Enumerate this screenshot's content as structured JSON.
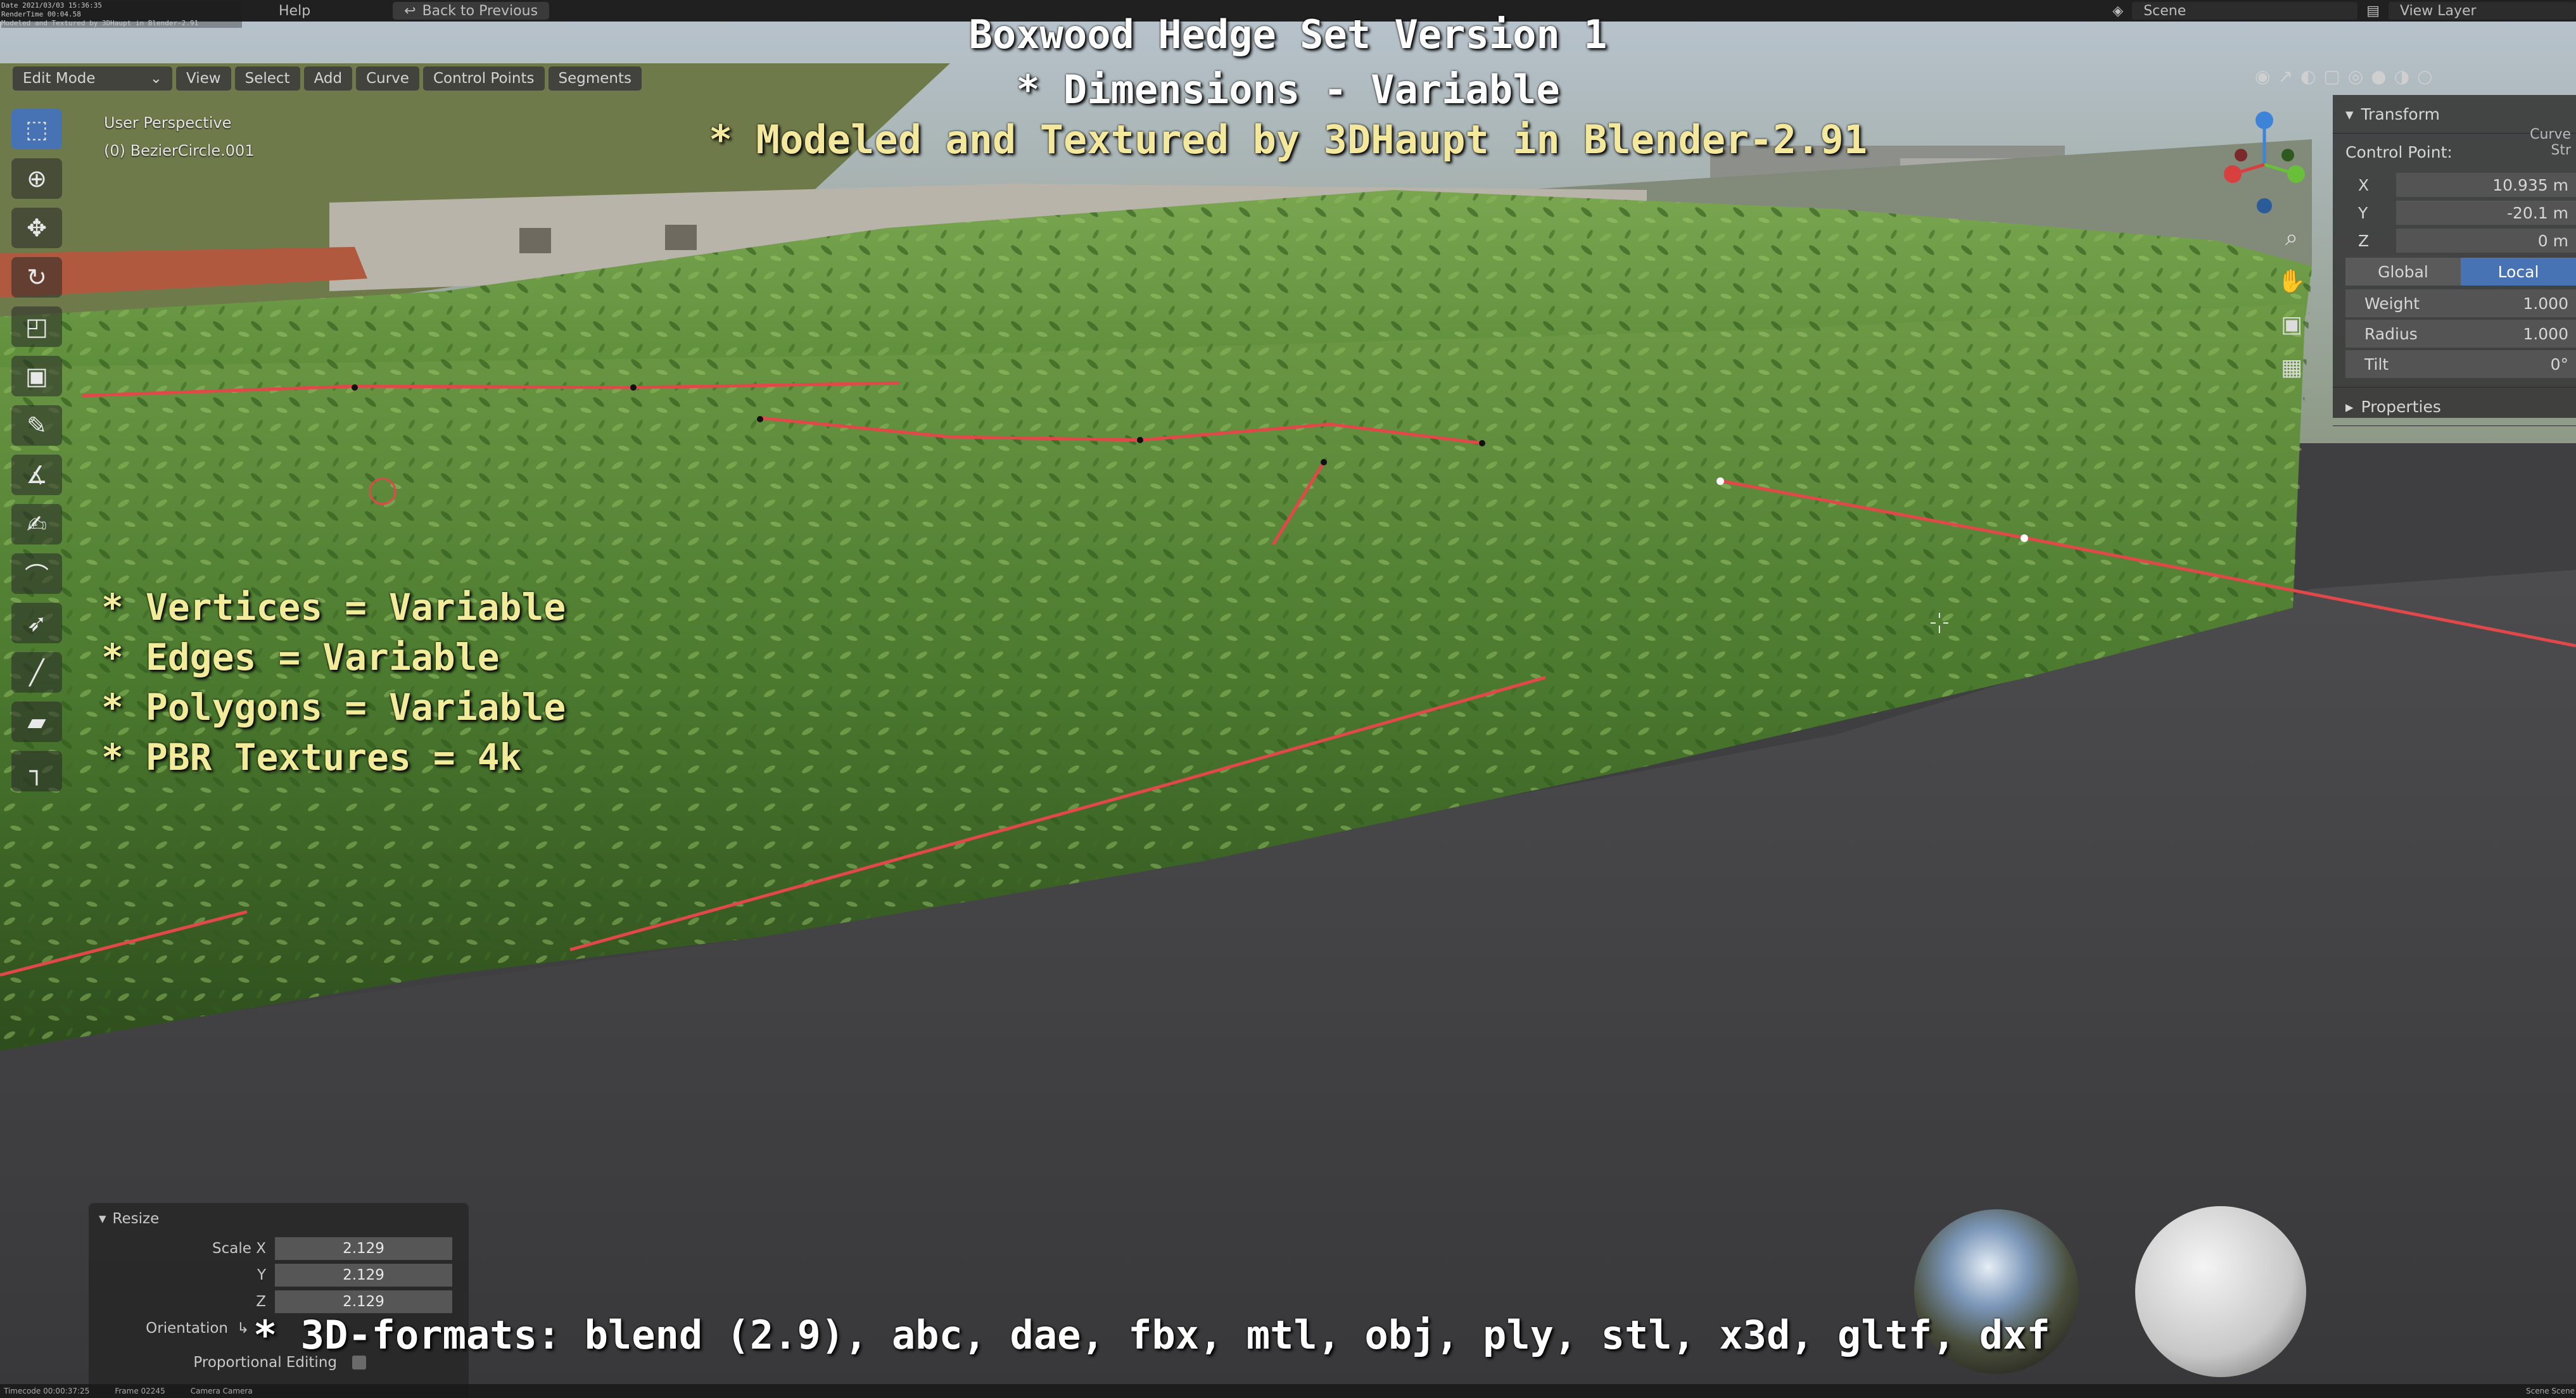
{
  "menu": {
    "help": "Help",
    "back_to_previous": "Back to Previous",
    "scene": "Scene",
    "view_layer": "View Layer"
  },
  "render_stats": [
    "Date 2021/03/03 15:36:35",
    "RenderTime 00:04.58",
    "Modeled and Textured by 3DHaupt in Blender-2.91"
  ],
  "header": {
    "mode": "Edit Mode",
    "menus": [
      "View",
      "Select",
      "Add",
      "Curve",
      "Control Points",
      "Segments"
    ]
  },
  "viewport": {
    "perspective": "User Perspective",
    "object": "(0) BezierCircle.001"
  },
  "overlay": {
    "title": "Boxwood Hedge Set Version 1",
    "dimensions": "* Dimensions - Variable",
    "modeled": "* Modeled and Textured by 3DHaupt in Blender-2.91",
    "stats": [
      "* Vertices = Variable",
      "* Edges = Variable",
      "* Polygons = Variable",
      "* PBR Textures = 4k"
    ],
    "formats": "* 3D-formats: blend (2.9), abc, dae, fbx, mtl, obj, ply, stl, x3d, gltf, dxf"
  },
  "sidebar": {
    "tab": "Curve Str",
    "section": "Transform",
    "control_point": "Control Point:",
    "x": {
      "label": "X",
      "value": "10.935 m"
    },
    "y": {
      "label": "Y",
      "value": "-20.1 m"
    },
    "z": {
      "label": "Z",
      "value": "0 m"
    },
    "global": "Global",
    "local": "Local",
    "weight": {
      "label": "Weight",
      "value": "1.000"
    },
    "radius": {
      "label": "Radius",
      "value": "1.000"
    },
    "tilt": {
      "label": "Tilt",
      "value": "0°"
    },
    "properties": "Properties"
  },
  "resize": {
    "title": "Resize",
    "scale_x": {
      "label": "Scale X",
      "value": "2.129"
    },
    "scale_y": {
      "label": "Y",
      "value": "2.129"
    },
    "scale_z": {
      "label": "Z",
      "value": "2.129"
    },
    "orientation": "Orientation",
    "proportional": "Proportional Editing"
  },
  "statusbar": {
    "timecode": "Timecode 00:00:37:25",
    "frame": "Frame 02245",
    "camera": "Camera Camera",
    "scene": "Scene Scene"
  },
  "colors": {
    "accent": "#4772b3",
    "hedge": "#4f7a32",
    "curve_line": "#e0484a",
    "overlay_yellow": "#f2ec9a"
  }
}
